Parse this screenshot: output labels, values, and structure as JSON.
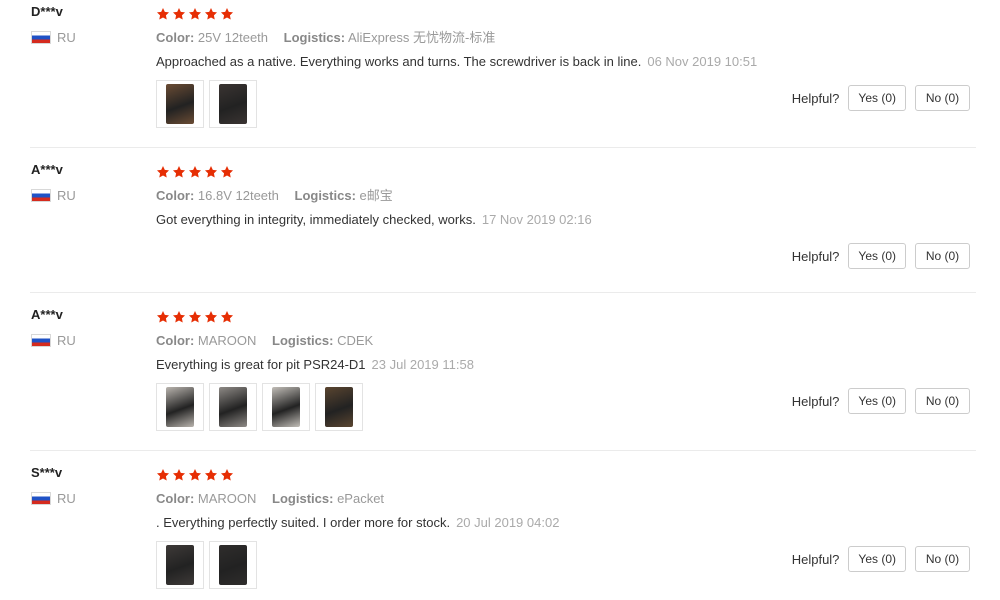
{
  "helpful_label": "Helpful?",
  "reviews": [
    {
      "name": "D***v",
      "country": "RU",
      "rating": 5,
      "color_key": "Color:",
      "color": "25V 12teeth",
      "logistics_key": "Logistics:",
      "logistics": "AliExpress 无忧物流-标准",
      "text": "Approached as a native. Everything works and turns. The screwdriver is back in line.",
      "date": "06 Nov 2019 10:51",
      "photos": [
        {
          "tone": "#6b4c34"
        },
        {
          "tone": "#3a3432"
        }
      ],
      "yes": "Yes (0)",
      "no": "No (0)"
    },
    {
      "name": "A***v",
      "country": "RU",
      "rating": 5,
      "color_key": "Color:",
      "color": "16.8V 12teeth",
      "logistics_key": "Logistics:",
      "logistics": "e邮宝",
      "text": "Got everything in integrity, immediately checked, works.",
      "date": "17 Nov 2019 02:16",
      "photos": [],
      "yes": "Yes (0)",
      "no": "No (0)"
    },
    {
      "name": "A***v",
      "country": "RU",
      "rating": 5,
      "color_key": "Color:",
      "color": "MAROON",
      "logistics_key": "Logistics:",
      "logistics": "CDEK",
      "text": "Everything is great for pit PSR24-D1",
      "date": "23 Jul 2019 11:58",
      "photos": [
        {
          "tone": "#b9b4ae"
        },
        {
          "tone": "#8e8a86"
        },
        {
          "tone": "#c2beb8"
        },
        {
          "tone": "#5a4530"
        }
      ],
      "yes": "Yes (0)",
      "no": "No (0)"
    },
    {
      "name": "S***v",
      "country": "RU",
      "rating": 5,
      "color_key": "Color:",
      "color": "MAROON",
      "logistics_key": "Logistics:",
      "logistics": "ePacket",
      "text": ". Everything perfectly suited. I order more for stock.",
      "date": "20 Jul 2019 04:02",
      "photos": [
        {
          "tone": "#3e3a38"
        },
        {
          "tone": "#2f2d2c"
        }
      ],
      "yes": "Yes (0)",
      "no": "No (0)"
    }
  ],
  "colors": {
    "star": "#e62e04",
    "divider": "#ebebeb",
    "muted_text": "#999999"
  }
}
